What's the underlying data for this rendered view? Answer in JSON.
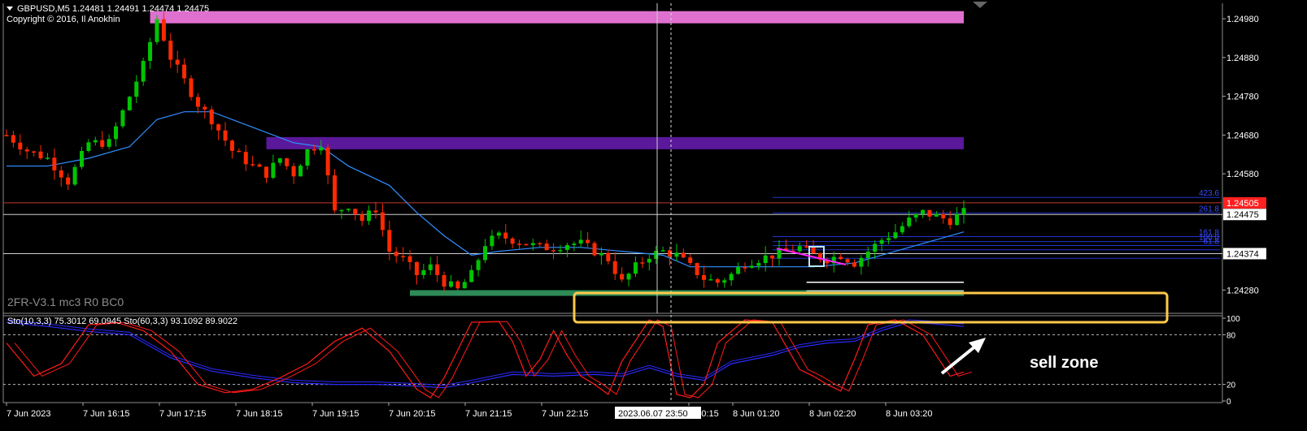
{
  "header": {
    "symbol_line": "GBPUSD,M5  1.24481 1.24491 1.24474 1.24475",
    "copyright": "Copyright © 2016, Il Anokhin"
  },
  "indicator_label": "2FR-V3.1 mc3 R0 BC0",
  "sub_header": "Sto(10,3,3) 75.3012 69.0945  Sto(60,3,3) 93.1092 89.9022",
  "annotation": "sell zone",
  "crosshair_time": "2023.06.07 23:50",
  "colors": {
    "background": "#000000",
    "bull": "#00c400",
    "bear": "#ff2a00",
    "ma": "#2f8fff",
    "magenta_zone": "#e070d0",
    "purple_zone": "#5a189a",
    "green_zone": "#2e8b57",
    "highlight_box": "#ffc84a",
    "stoch_fast": "#ff1a1a",
    "stoch_slow": "#2a2aff",
    "fib": "#2233cc",
    "current_price_label": "#ff2020"
  },
  "chart_data": {
    "type": "candlestick",
    "price_ylim": [
      1.2422,
      1.2502
    ],
    "price_ticks": [
      "1.24980",
      "1.24880",
      "1.24780",
      "1.24680",
      "1.24580",
      "1.24280"
    ],
    "price_labels": [
      {
        "value": 1.24505,
        "text": "1.24505",
        "style": "red"
      },
      {
        "value": 1.24475,
        "text": "1.24475",
        "style": "white"
      },
      {
        "value": 1.24374,
        "text": "1.24374",
        "style": "white"
      }
    ],
    "time_labels": [
      "7 Jun 2023",
      "7 Jun 16:15",
      "7 Jun 17:15",
      "7 Jun 18:15",
      "7 Jun 19:15",
      "7 Jun 20:15",
      "7 Jun 21:15",
      "7 Jun 22:15",
      "n 00:15",
      "8 Jun 01:20",
      "8 Jun 02:20",
      "8 Jun 03:20"
    ],
    "close_path": [
      [
        0,
        1.2468
      ],
      [
        3,
        1.2464
      ],
      [
        6,
        1.2462
      ],
      [
        9,
        1.2456
      ],
      [
        12,
        1.2466
      ],
      [
        15,
        1.2466
      ],
      [
        18,
        1.2478
      ],
      [
        20,
        1.2486
      ],
      [
        22,
        1.2498
      ],
      [
        24,
        1.2488
      ],
      [
        26,
        1.2482
      ],
      [
        28,
        1.2476
      ],
      [
        30,
        1.2472
      ],
      [
        33,
        1.2464
      ],
      [
        36,
        1.246
      ],
      [
        38,
        1.2458
      ],
      [
        40,
        1.2462
      ],
      [
        42,
        1.2458
      ],
      [
        44,
        1.2464
      ],
      [
        46,
        1.2466
      ],
      [
        48,
        1.2448
      ],
      [
        50,
        1.245
      ],
      [
        52,
        1.2446
      ],
      [
        54,
        1.2449
      ],
      [
        56,
        1.2438
      ],
      [
        58,
        1.2436
      ],
      [
        60,
        1.2432
      ],
      [
        62,
        1.2434
      ],
      [
        64,
        1.243
      ],
      [
        66,
        1.2428
      ],
      [
        68,
        1.2432
      ],
      [
        70,
        1.244
      ],
      [
        72,
        1.2442
      ],
      [
        74,
        1.2441
      ],
      [
        76,
        1.244
      ],
      [
        78,
        1.2439
      ],
      [
        80,
        1.2439
      ],
      [
        82,
        1.244
      ],
      [
        84,
        1.244
      ],
      [
        86,
        1.2438
      ],
      [
        88,
        1.2436
      ],
      [
        90,
        1.243
      ],
      [
        92,
        1.2434
      ],
      [
        94,
        1.2437
      ],
      [
        96,
        1.2438
      ],
      [
        98,
        1.2437
      ],
      [
        100,
        1.2434
      ],
      [
        102,
        1.2431
      ],
      [
        104,
        1.243
      ],
      [
        106,
        1.2432
      ],
      [
        108,
        1.2435
      ],
      [
        110,
        1.2436
      ],
      [
        112,
        1.2437
      ],
      [
        114,
        1.2438
      ],
      [
        116,
        1.2439
      ],
      [
        118,
        1.2437
      ],
      [
        120,
        1.2436
      ],
      [
        122,
        1.2437
      ],
      [
        124,
        1.2435
      ],
      [
        126,
        1.2438
      ],
      [
        128,
        1.2441
      ],
      [
        130,
        1.2443
      ],
      [
        132,
        1.2446
      ],
      [
        134,
        1.2448
      ],
      [
        136,
        1.2447
      ],
      [
        138,
        1.2446
      ],
      [
        140,
        1.2448
      ]
    ],
    "ma_path": [
      [
        0,
        1.246
      ],
      [
        6,
        1.246
      ],
      [
        12,
        1.2462
      ],
      [
        18,
        1.2465
      ],
      [
        22,
        1.2472
      ],
      [
        26,
        1.2474
      ],
      [
        30,
        1.2474
      ],
      [
        36,
        1.247
      ],
      [
        42,
        1.2466
      ],
      [
        46,
        1.2465
      ],
      [
        50,
        1.246
      ],
      [
        56,
        1.2455
      ],
      [
        60,
        1.2448
      ],
      [
        64,
        1.2442
      ],
      [
        68,
        1.2437
      ],
      [
        72,
        1.2438
      ],
      [
        78,
        1.2439
      ],
      [
        84,
        1.2439
      ],
      [
        90,
        1.2438
      ],
      [
        96,
        1.2437
      ],
      [
        100,
        1.2434
      ],
      [
        106,
        1.2434
      ],
      [
        112,
        1.2434
      ],
      [
        118,
        1.2434
      ],
      [
        124,
        1.2435
      ],
      [
        130,
        1.2438
      ],
      [
        136,
        1.2441
      ],
      [
        140,
        1.2443
      ]
    ],
    "zones": [
      {
        "name": "magenta",
        "from": 21,
        "to": 140,
        "low": 1.24965,
        "high": 1.24985
      },
      {
        "name": "purple",
        "from": 38,
        "to": 140,
        "low": 1.2464,
        "high": 1.2466
      },
      {
        "name": "green",
        "from": 59,
        "to": 140,
        "low": 1.24255,
        "high": 1.24265
      }
    ],
    "fib_levels": [
      {
        "value": 1.24519,
        "text": "423.6"
      },
      {
        "value": 1.24479,
        "text": "261.8"
      },
      {
        "value": 1.24418,
        "text": "161.8"
      },
      {
        "value": 1.24405,
        "text": "100.0"
      },
      {
        "value": 1.24395,
        "text": "61.8"
      },
      {
        "value": 1.24384,
        "text": ""
      },
      {
        "value": 1.24362,
        "text": ""
      }
    ],
    "stoch": {
      "ylim": [
        0,
        100
      ],
      "ticks": [
        "100",
        "80",
        "20",
        "0"
      ],
      "fast": [
        [
          0,
          70
        ],
        [
          4,
          30
        ],
        [
          8,
          45
        ],
        [
          12,
          92
        ],
        [
          16,
          95
        ],
        [
          20,
          85
        ],
        [
          24,
          60
        ],
        [
          28,
          20
        ],
        [
          32,
          10
        ],
        [
          36,
          14
        ],
        [
          40,
          28
        ],
        [
          44,
          45
        ],
        [
          48,
          72
        ],
        [
          52,
          88
        ],
        [
          56,
          60
        ],
        [
          60,
          14
        ],
        [
          62,
          4
        ],
        [
          64,
          28
        ],
        [
          68,
          95
        ],
        [
          72,
          96
        ],
        [
          74,
          72
        ],
        [
          76,
          30
        ],
        [
          78,
          50
        ],
        [
          80,
          85
        ],
        [
          82,
          55
        ],
        [
          84,
          30
        ],
        [
          86,
          20
        ],
        [
          88,
          8
        ],
        [
          90,
          48
        ],
        [
          94,
          98
        ],
        [
          96,
          90
        ],
        [
          98,
          8
        ],
        [
          100,
          4
        ],
        [
          102,
          20
        ],
        [
          104,
          70
        ],
        [
          108,
          98
        ],
        [
          112,
          95
        ],
        [
          116,
          38
        ],
        [
          118,
          30
        ],
        [
          120,
          20
        ],
        [
          122,
          12
        ],
        [
          124,
          50
        ],
        [
          126,
          92
        ],
        [
          130,
          98
        ],
        [
          134,
          80
        ],
        [
          138,
          30
        ],
        [
          140,
          35
        ]
      ],
      "slow": [
        [
          0,
          95
        ],
        [
          6,
          90
        ],
        [
          12,
          84
        ],
        [
          18,
          80
        ],
        [
          24,
          52
        ],
        [
          30,
          36
        ],
        [
          36,
          28
        ],
        [
          42,
          22
        ],
        [
          48,
          20
        ],
        [
          54,
          20
        ],
        [
          60,
          18
        ],
        [
          64,
          16
        ],
        [
          68,
          22
        ],
        [
          74,
          32
        ],
        [
          80,
          30
        ],
        [
          86,
          32
        ],
        [
          90,
          30
        ],
        [
          94,
          40
        ],
        [
          98,
          30
        ],
        [
          102,
          25
        ],
        [
          106,
          45
        ],
        [
          112,
          55
        ],
        [
          116,
          65
        ],
        [
          120,
          70
        ],
        [
          124,
          72
        ],
        [
          128,
          85
        ],
        [
          132,
          95
        ],
        [
          136,
          93
        ],
        [
          140,
          90
        ]
      ]
    }
  }
}
